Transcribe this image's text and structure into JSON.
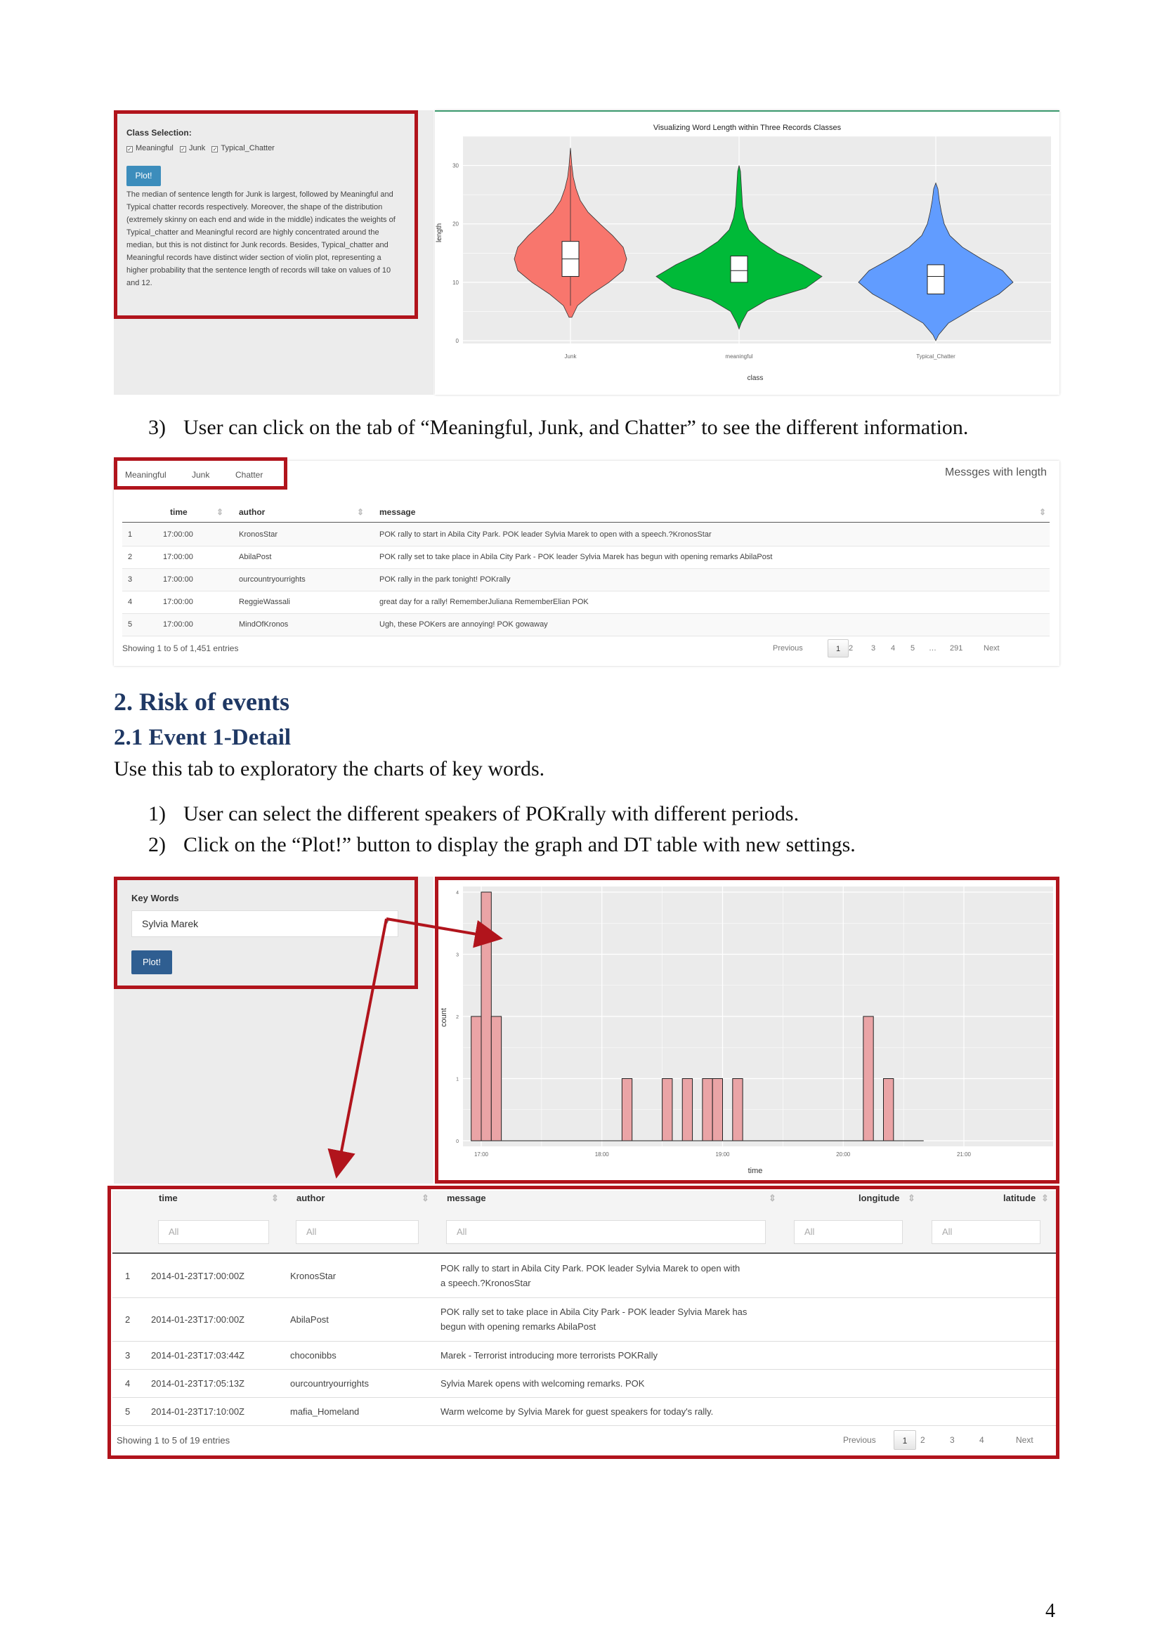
{
  "violin_panel": {
    "class_selection_label": "Class Selection:",
    "checkboxes": [
      "Meaningful",
      "Junk",
      "Typical_Chatter"
    ],
    "plot_button": "Plot!",
    "description": "The median of sentence length for Junk is largest, followed by Meaningful and Typical chatter records respectively. Moreover, the shape of the distribution (extremely skinny on each end and wide in the middle) indicates the weights of Typical_chatter and Meaningful record are highly concentrated around the median, but this is not distinct for Junk records. Besides, Typical_chatter and Meaningful records have distinct wider section of violin plot, representing a higher probability that the sentence length of records will take on values of 10 and 12."
  },
  "violin_chart": {
    "title": "Visualizing Word Length within Three Records Classes",
    "ylabel": "length",
    "xlabel": "class",
    "ytick_labels": [
      "30",
      "20",
      "10",
      "0"
    ],
    "categories": [
      "Junk",
      "meaningful",
      "Typical_Chatter"
    ],
    "colors": [
      "#f8766d",
      "#00ba38",
      "#619cff"
    ]
  },
  "step3": {
    "num": "3)",
    "text": "User can click on the tab of “Meaningful, Junk, and Chatter” to see the different information."
  },
  "messages_table": {
    "tabs": [
      "Meaningful",
      "Junk",
      "Chatter"
    ],
    "heading": "Messges with length",
    "columns": [
      "time",
      "author",
      "message"
    ],
    "rows": [
      [
        "1",
        "17:00:00",
        "KronosStar",
        "POK rally to start in Abila City Park. POK leader Sylvia Marek to open with a speech.?KronosStar"
      ],
      [
        "2",
        "17:00:00",
        "AbilaPost",
        "POK rally set to take place in Abila City Park - POK leader Sylvia Marek has begun with opening remarks AbilaPost"
      ],
      [
        "3",
        "17:00:00",
        "ourcountryourrights",
        "POK rally in the park tonight! POKrally"
      ],
      [
        "4",
        "17:00:00",
        "ReggieWassali",
        "great day for a rally! RememberJuliana RememberElian POK"
      ],
      [
        "5",
        "17:00:00",
        "MindOfKronos",
        "Ugh, these POKers are annoying! POK gowaway"
      ]
    ],
    "info": "Showing 1 to 5 of 1,451 entries",
    "pager": [
      "Previous",
      "1",
      "2",
      "3",
      "4",
      "5",
      "…",
      "291",
      "Next"
    ]
  },
  "section2": {
    "heading": "2. Risk of events",
    "subheading": "2.1 Event 1-Detail",
    "intro": "Use this tab to exploratory the charts of key words."
  },
  "steps": [
    {
      "num": "1)",
      "text": "User can select the different speakers of POKrally with different periods."
    },
    {
      "num": "2)",
      "text": "Click on the “Plot!” button to display the graph and DT table with new settings."
    }
  ],
  "keywords_panel": {
    "label": "Key Words",
    "selected": "Sylvia Marek",
    "plot_button": "Plot!"
  },
  "chart_data": {
    "type": "bar",
    "title": "",
    "xlabel": "time",
    "ylabel": "count",
    "ylim": [
      0,
      4
    ],
    "x_tick_labels": [
      "17:00",
      "18:00",
      "19:00",
      "20:00",
      "21:00"
    ],
    "y_tick_labels": [
      "0",
      "1",
      "2",
      "3",
      "4"
    ],
    "x_start_label": "17:00",
    "bins_minutes": [
      0,
      5,
      10,
      15,
      20,
      25,
      30,
      35,
      40,
      45,
      50,
      55,
      60,
      65,
      70,
      75,
      80,
      85,
      90,
      95,
      100,
      105,
      110,
      115,
      120,
      125,
      130,
      135,
      140,
      145,
      150,
      155,
      160,
      165,
      170,
      175,
      180,
      185,
      190,
      195,
      200,
      205,
      210,
      215,
      220,
      225,
      230,
      235
    ],
    "counts": [
      2,
      4,
      2,
      0,
      0,
      0,
      0,
      0,
      0,
      0,
      0,
      0,
      0,
      0,
      0,
      1,
      0,
      0,
      0,
      1,
      0,
      1,
      0,
      1,
      1,
      0,
      1,
      0,
      0,
      0,
      0,
      0,
      0,
      0,
      0,
      0,
      0,
      0,
      0,
      0,
      0,
      0,
      0,
      0,
      0,
      0,
      0,
      0
    ],
    "extra_bins": [
      {
        "minute": 195,
        "count": 2
      },
      {
        "minute": 205,
        "count": 1
      }
    ],
    "fill": "#eaa4a6"
  },
  "dt_table": {
    "columns": [
      "time",
      "author",
      "message",
      "longitude",
      "latitude"
    ],
    "filter_placeholder": "All",
    "rows": [
      [
        "1",
        "2014-01-23T17:00:00Z",
        "KronosStar",
        "POK rally to start in Abila City Park. POK leader Sylvia Marek to open with",
        "a speech.?KronosStar"
      ],
      [
        "2",
        "2014-01-23T17:00:00Z",
        "AbilaPost",
        "POK rally set to take place in Abila City Park - POK leader Sylvia Marek has",
        "begun with opening remarks AbilaPost"
      ],
      [
        "3",
        "2014-01-23T17:03:44Z",
        "choconibbs",
        "Marek - Terrorist introducing more terrorists POKRally",
        ""
      ],
      [
        "4",
        "2014-01-23T17:05:13Z",
        "ourcountryourrights",
        "Sylvia Marek opens with welcoming remarks. POK",
        ""
      ],
      [
        "5",
        "2014-01-23T17:10:00Z",
        "mafia_Homeland",
        "Warm welcome by Sylvia Marek for guest speakers for today's rally.",
        ""
      ]
    ],
    "info": "Showing 1 to 5 of 19 entries",
    "pager": [
      "Previous",
      "1",
      "2",
      "3",
      "4",
      "Next"
    ]
  },
  "page_number": "4"
}
